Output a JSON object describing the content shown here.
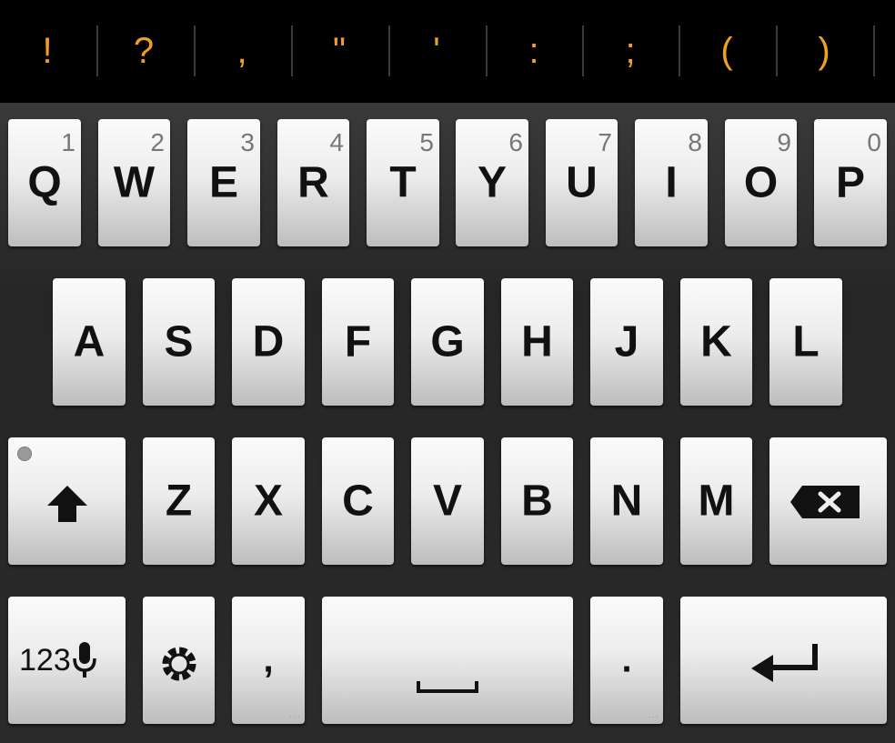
{
  "suggestions": [
    "!",
    "?",
    ",",
    "\"",
    "'",
    ":",
    ";",
    "(",
    ")"
  ],
  "rows": {
    "row1": [
      {
        "label": "Q",
        "hint": "1"
      },
      {
        "label": "W",
        "hint": "2"
      },
      {
        "label": "E",
        "hint": "3"
      },
      {
        "label": "R",
        "hint": "4"
      },
      {
        "label": "T",
        "hint": "5"
      },
      {
        "label": "Y",
        "hint": "6"
      },
      {
        "label": "U",
        "hint": "7"
      },
      {
        "label": "I",
        "hint": "8"
      },
      {
        "label": "O",
        "hint": "9"
      },
      {
        "label": "P",
        "hint": "0"
      }
    ],
    "row2": [
      "A",
      "S",
      "D",
      "F",
      "G",
      "H",
      "J",
      "K",
      "L"
    ],
    "row3": [
      "Z",
      "X",
      "C",
      "V",
      "B",
      "N",
      "M"
    ]
  },
  "bottom": {
    "symbols_label": "123",
    "comma": ",",
    "period": "."
  },
  "colors": {
    "suggestion_text": "#f0a020",
    "key_face": "#ececec",
    "background": "#2b2b2b"
  },
  "icons": {
    "shift": "shift-arrow-icon",
    "backspace": "backspace-icon",
    "mic": "microphone-icon",
    "settings": "settings-gear-icon",
    "space": "space-bar-icon",
    "enter": "enter-return-icon"
  }
}
